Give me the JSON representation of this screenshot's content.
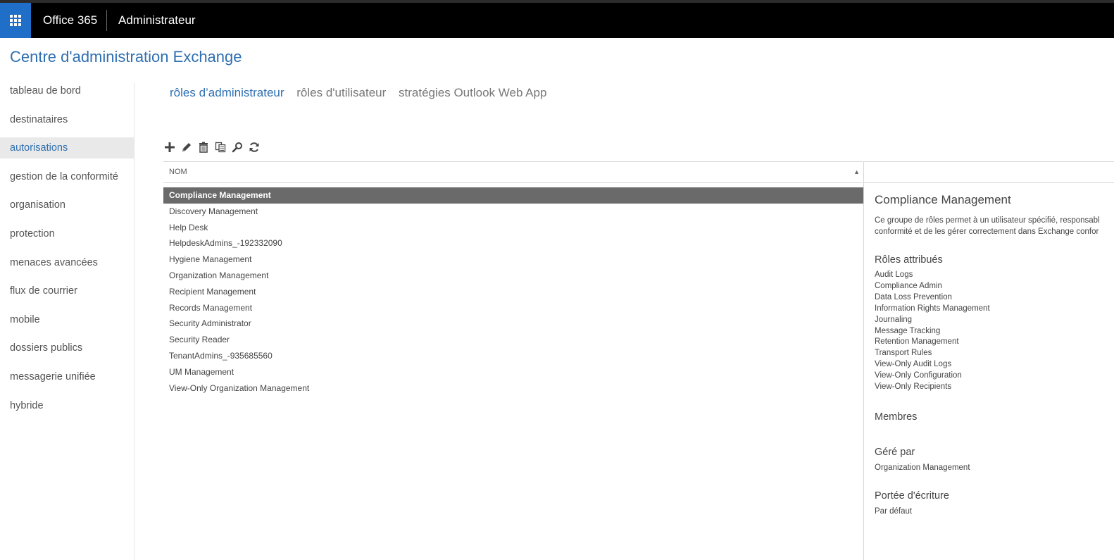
{
  "app": {
    "brand": "Office 365",
    "section": "Administrateur",
    "title": "Centre d'administration Exchange"
  },
  "sidebar": {
    "items": [
      {
        "label": "tableau de bord",
        "active": false
      },
      {
        "label": "destinataires",
        "active": false
      },
      {
        "label": "autorisations",
        "active": true
      },
      {
        "label": "gestion de la conformité",
        "active": false
      },
      {
        "label": "organisation",
        "active": false
      },
      {
        "label": "protection",
        "active": false
      },
      {
        "label": "menaces avancées",
        "active": false
      },
      {
        "label": "flux de courrier",
        "active": false
      },
      {
        "label": "mobile",
        "active": false
      },
      {
        "label": "dossiers publics",
        "active": false
      },
      {
        "label": "messagerie unifiée",
        "active": false
      },
      {
        "label": "hybride",
        "active": false
      }
    ]
  },
  "tabs": [
    {
      "label": "rôles d’administrateur",
      "active": true
    },
    {
      "label": "rôles d'utilisateur",
      "active": false
    },
    {
      "label": "stratégies Outlook Web App",
      "active": false
    }
  ],
  "toolbar": {
    "icons": [
      "add-icon",
      "edit-icon",
      "delete-icon",
      "copy-icon",
      "search-icon",
      "refresh-icon"
    ]
  },
  "list": {
    "column_header": "NOM",
    "sort": "ascending",
    "rows": [
      {
        "name": "Compliance Management",
        "selected": true
      },
      {
        "name": "Discovery Management",
        "selected": false
      },
      {
        "name": "Help Desk",
        "selected": false
      },
      {
        "name": "HelpdeskAdmins_-192332090",
        "selected": false
      },
      {
        "name": "Hygiene Management",
        "selected": false
      },
      {
        "name": "Organization Management",
        "selected": false
      },
      {
        "name": "Recipient Management",
        "selected": false
      },
      {
        "name": "Records Management",
        "selected": false
      },
      {
        "name": "Security Administrator",
        "selected": false
      },
      {
        "name": "Security Reader",
        "selected": false
      },
      {
        "name": "TenantAdmins_-935685560",
        "selected": false
      },
      {
        "name": "UM Management",
        "selected": false
      },
      {
        "name": "View-Only Organization Management",
        "selected": false
      }
    ]
  },
  "details": {
    "title": "Compliance Management",
    "description_line1": "Ce groupe de rôles permet à un utilisateur spécifié, responsabl",
    "description_line2": "conformité et de les gérer correctement dans Exchange confor",
    "roles_heading": "Rôles attribués",
    "roles": [
      "Audit Logs",
      "Compliance Admin",
      "Data Loss Prevention",
      "Information Rights Management",
      "Journaling",
      "Message Tracking",
      "Retention Management",
      "Transport Rules",
      "View-Only Audit Logs",
      "View-Only Configuration",
      "View-Only Recipients"
    ],
    "members_heading": "Membres",
    "managed_by_heading": "Géré par",
    "managed_by": "Organization Management",
    "write_scope_heading": "Portée d'écriture",
    "write_scope": "Par défaut"
  },
  "colors": {
    "accent": "#2e6fb0",
    "launcher": "#1f6fc8",
    "topbar": "#000000",
    "selected_row": "#6a6a6a"
  }
}
